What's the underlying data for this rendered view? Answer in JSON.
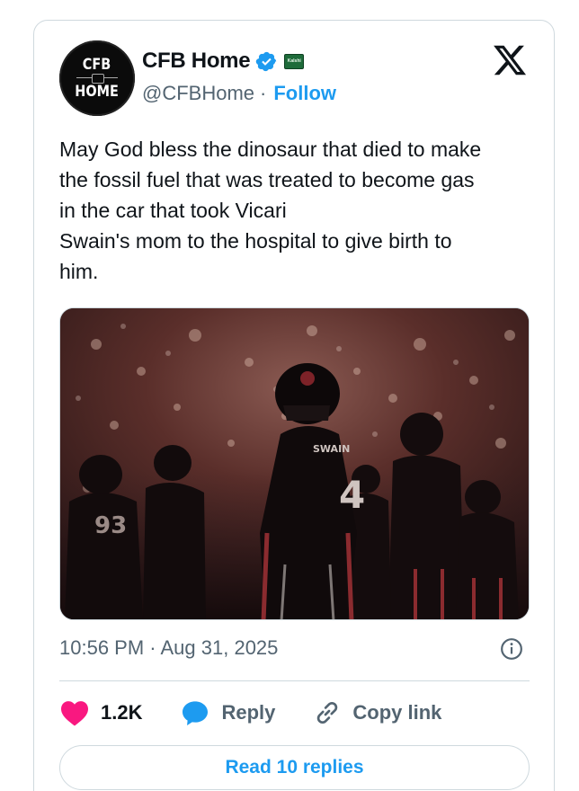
{
  "author": {
    "display_name": "CFB Home",
    "handle": "@CFBHome",
    "separator": "·",
    "follow_label": "Follow",
    "avatar_line1": "CFB",
    "avatar_line2": "HOME",
    "affiliate_badge_text": "Kalshi",
    "verified_color": "#1d9bf0"
  },
  "tweet": {
    "text": "May God bless the dinosaur that died to make\nthe fossil fuel that was treated to become gas\nin the car that took Vicari\nSwain's mom to the hospital to give birth to\nhim.",
    "timestamp": "10:56 PM · Aug 31, 2025"
  },
  "media": {
    "jersey_numbers": [
      "93",
      "4"
    ],
    "name_on_jersey": "SWAIN"
  },
  "actions": {
    "like_count": "1.2K",
    "reply_label": "Reply",
    "copy_label": "Copy link"
  },
  "read_replies_label": "Read 10 replies",
  "icons": {
    "x_logo": "x-logo-icon",
    "verified": "verified-badge-icon",
    "info": "info-icon",
    "like": "heart-icon",
    "reply": "speech-bubble-icon",
    "copy": "link-icon"
  },
  "colors": {
    "accent": "#1d9bf0",
    "like": "#f91880",
    "muted": "#536471",
    "border": "#cfd9de"
  }
}
